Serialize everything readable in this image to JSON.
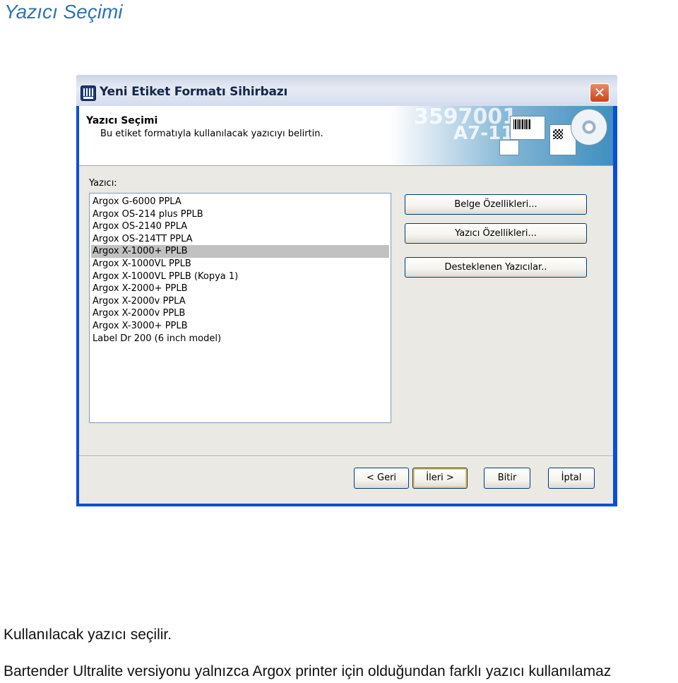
{
  "document": {
    "heading": "Yazıcı Seçimi",
    "caption": "Kullanılacak yazıcı seçilir.",
    "body_line": "Bartender Ultralite versiyonu yalnızca Argox printer için olduğundan farklı yazıcı kullanılamaz"
  },
  "dialog": {
    "title": "Yeni Etiket Formatı Sihirbazı",
    "close_glyph": "✕",
    "header": {
      "title": "Yazıcı Seçimi",
      "subtitle": "Bu etiket formatıyla kullanılacak yazıcıyı belirtin.",
      "banner_text_1": "3597001",
      "banner_text_2": "A7-118"
    },
    "printer_label": "Yazıcı:",
    "printers": [
      "Argox G-6000 PPLA",
      "Argox OS-214 plus PPLB",
      "Argox OS-2140 PPLA",
      "Argox OS-214TT PPLA",
      "Argox X-1000+ PPLB",
      "Argox X-1000VL PPLB",
      "Argox X-1000VL PPLB (Kopya 1)",
      "Argox X-2000+ PPLB",
      "Argox X-2000v PPLA",
      "Argox X-2000v PPLB",
      "Argox X-3000+ PPLB",
      "Label Dr 200 (6 inch model)"
    ],
    "selected_printer": "Argox X-1000+ PPLB",
    "side_buttons": {
      "belge": "Belge Özellikleri...",
      "yazici": "Yazıcı Özellikleri...",
      "destek": "Desteklenen Yazıcılar.."
    },
    "nav_buttons": {
      "back": "< Geri",
      "next": "İleri >",
      "finish": "Bitir",
      "cancel": "İptal"
    }
  }
}
